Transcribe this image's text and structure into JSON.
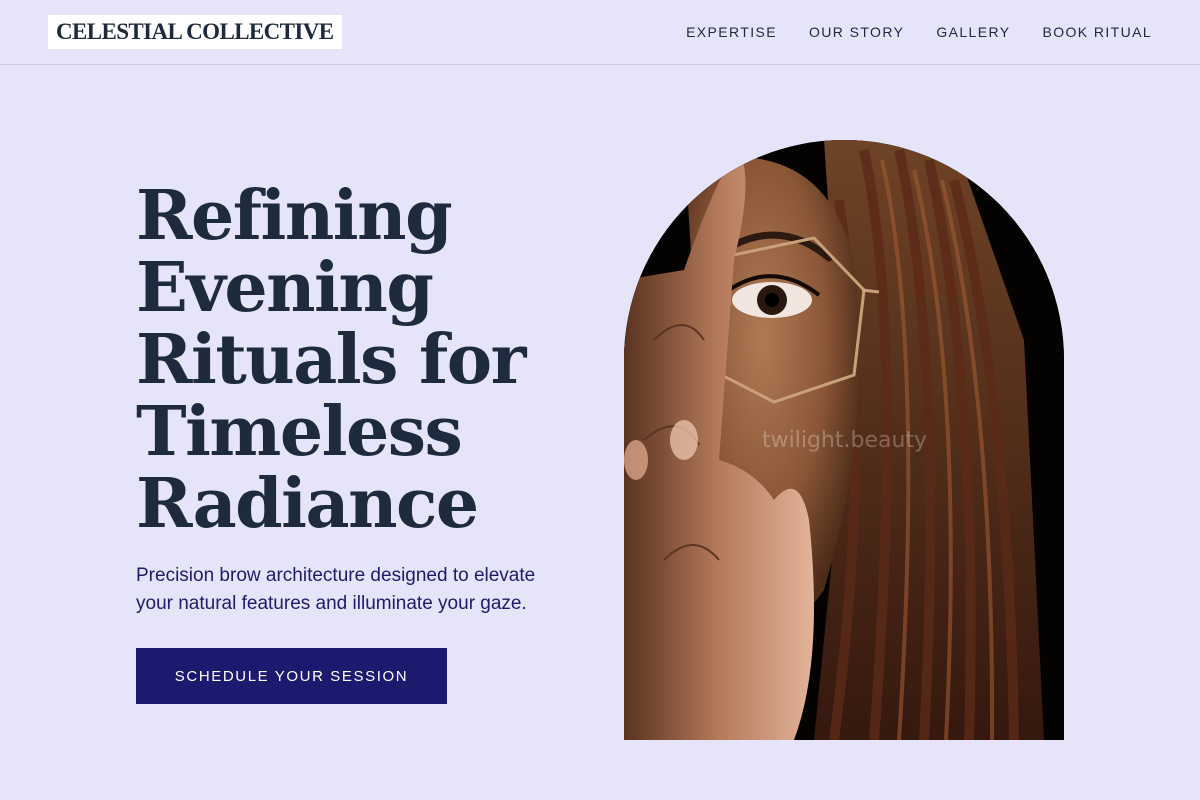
{
  "brand": {
    "name": "CELESTIAL COLLECTIVE"
  },
  "nav": {
    "items": [
      {
        "label": "EXPERTISE"
      },
      {
        "label": "OUR STORY"
      },
      {
        "label": "GALLERY"
      },
      {
        "label": "BOOK RITUAL"
      }
    ]
  },
  "hero": {
    "headline": "Refining Evening Rituals for Timeless Radiance",
    "subtext": "Precision brow architecture designed to elevate your natural features and illuminate your gaze.",
    "cta_label": "SCHEDULE YOUR SESSION"
  },
  "image": {
    "watermark": "twilight.beauty"
  },
  "colors": {
    "background": "#e6e4f9",
    "primary": "#1c1a6e",
    "text_dark": "#1e2a3d"
  }
}
